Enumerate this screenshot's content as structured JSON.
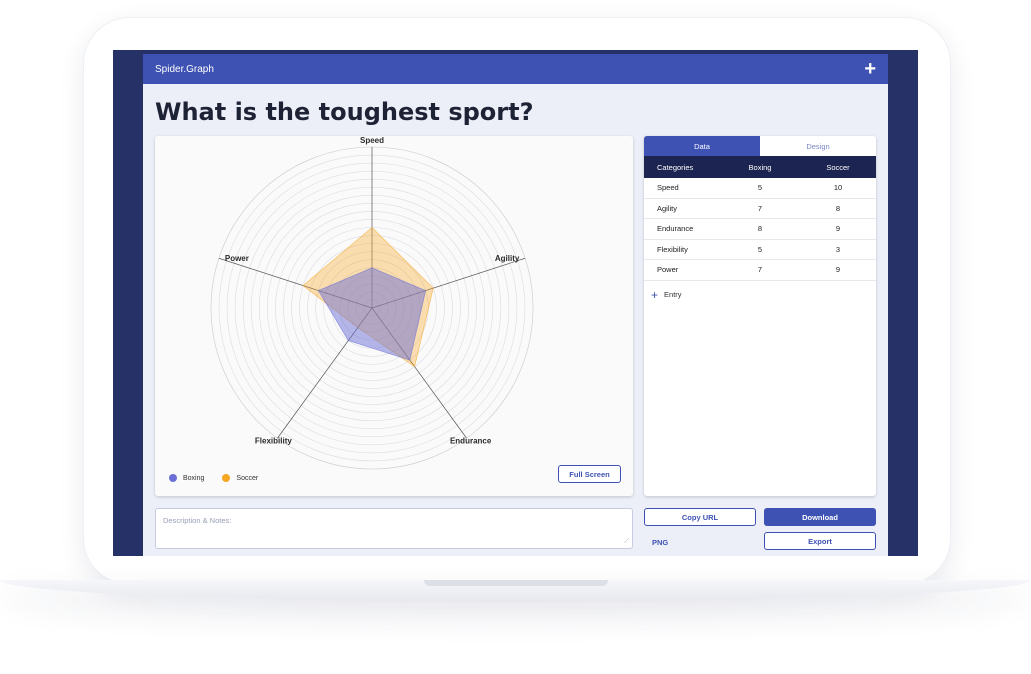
{
  "app": {
    "brand": "Spider.Graph",
    "add_icon": "plus-icon",
    "title": "What is the toughest sport?"
  },
  "tabs": [
    {
      "label": "Data",
      "active": true
    },
    {
      "label": "Design",
      "active": false
    }
  ],
  "table": {
    "headers": [
      "Categories",
      "Boxing",
      "Soccer"
    ],
    "rows": [
      [
        "Speed",
        "5",
        "10"
      ],
      [
        "Agility",
        "7",
        "8"
      ],
      [
        "Endurance",
        "8",
        "9"
      ],
      [
        "Flexibility",
        "5",
        "3"
      ],
      [
        "Power",
        "7",
        "9"
      ]
    ],
    "add_entry_label": "Entry"
  },
  "chart_data": {
    "type": "radar",
    "title": "",
    "axes": [
      "Speed",
      "Agility",
      "Endurance",
      "Flexibility",
      "Power"
    ],
    "max": 20,
    "grid_rings": 20,
    "series": [
      {
        "name": "Boxing",
        "values": [
          5,
          7,
          8,
          5,
          7
        ],
        "color": "#6b6fd6"
      },
      {
        "name": "Soccer",
        "values": [
          10,
          8,
          9,
          3,
          9
        ],
        "color": "#f5a623"
      }
    ],
    "legend_position": "bottom-left"
  },
  "chart_controls": {
    "full_screen_label": "Full Screen"
  },
  "notes": {
    "placeholder": "Description & Notes:"
  },
  "actions": {
    "copy_url": "Copy URL",
    "download": "Download",
    "format": "PNG",
    "export": "Export"
  },
  "colors": {
    "primary": "#3e52b3",
    "dark": "#1c2551",
    "frame": "#263168"
  }
}
